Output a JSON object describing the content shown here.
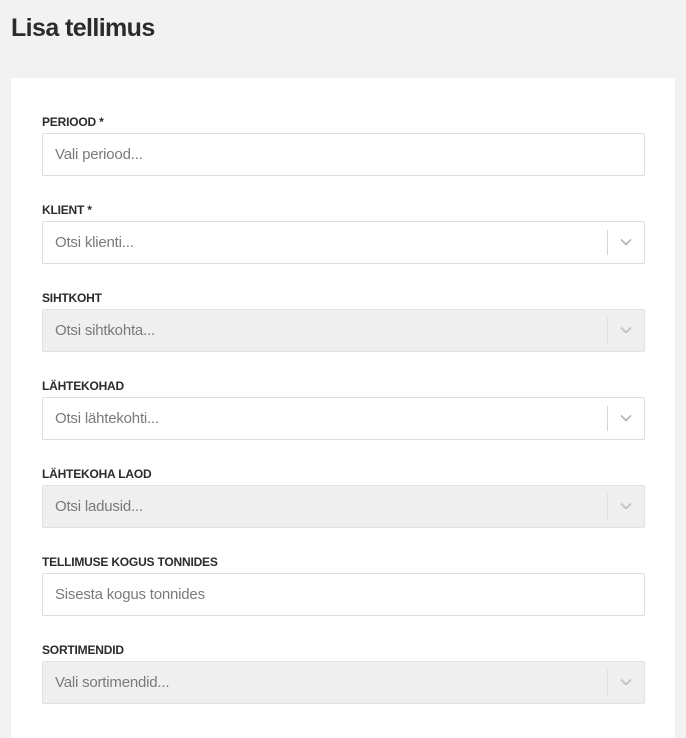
{
  "page": {
    "title": "Lisa tellimus"
  },
  "form": {
    "period": {
      "label": "PERIOOD *",
      "placeholder": "Vali periood...",
      "value": ""
    },
    "client": {
      "label": "KLIENT *",
      "placeholder": "Otsi klienti..."
    },
    "destination": {
      "label": "SIHTKOHT",
      "placeholder": "Otsi sihtkohta..."
    },
    "origins": {
      "label": "LÄHTEKOHAD",
      "placeholder": "Otsi lähtekohti..."
    },
    "origin_warehouses": {
      "label": "LÄHTEKOHA LAOD",
      "placeholder": "Otsi ladusid..."
    },
    "quantity": {
      "label": "TELLIMUSE KOGUS TONNIDES",
      "placeholder": "Sisesta kogus tonnides",
      "value": ""
    },
    "assortments": {
      "label": "SORTIMENDID",
      "placeholder": "Vali sortimendid..."
    }
  },
  "icons": {
    "dropdown": "chevron-down-icon"
  },
  "colors": {
    "background": "#f2f2f2",
    "card": "#ffffff",
    "disabled_field": "#efefef",
    "border": "#dddddd"
  }
}
